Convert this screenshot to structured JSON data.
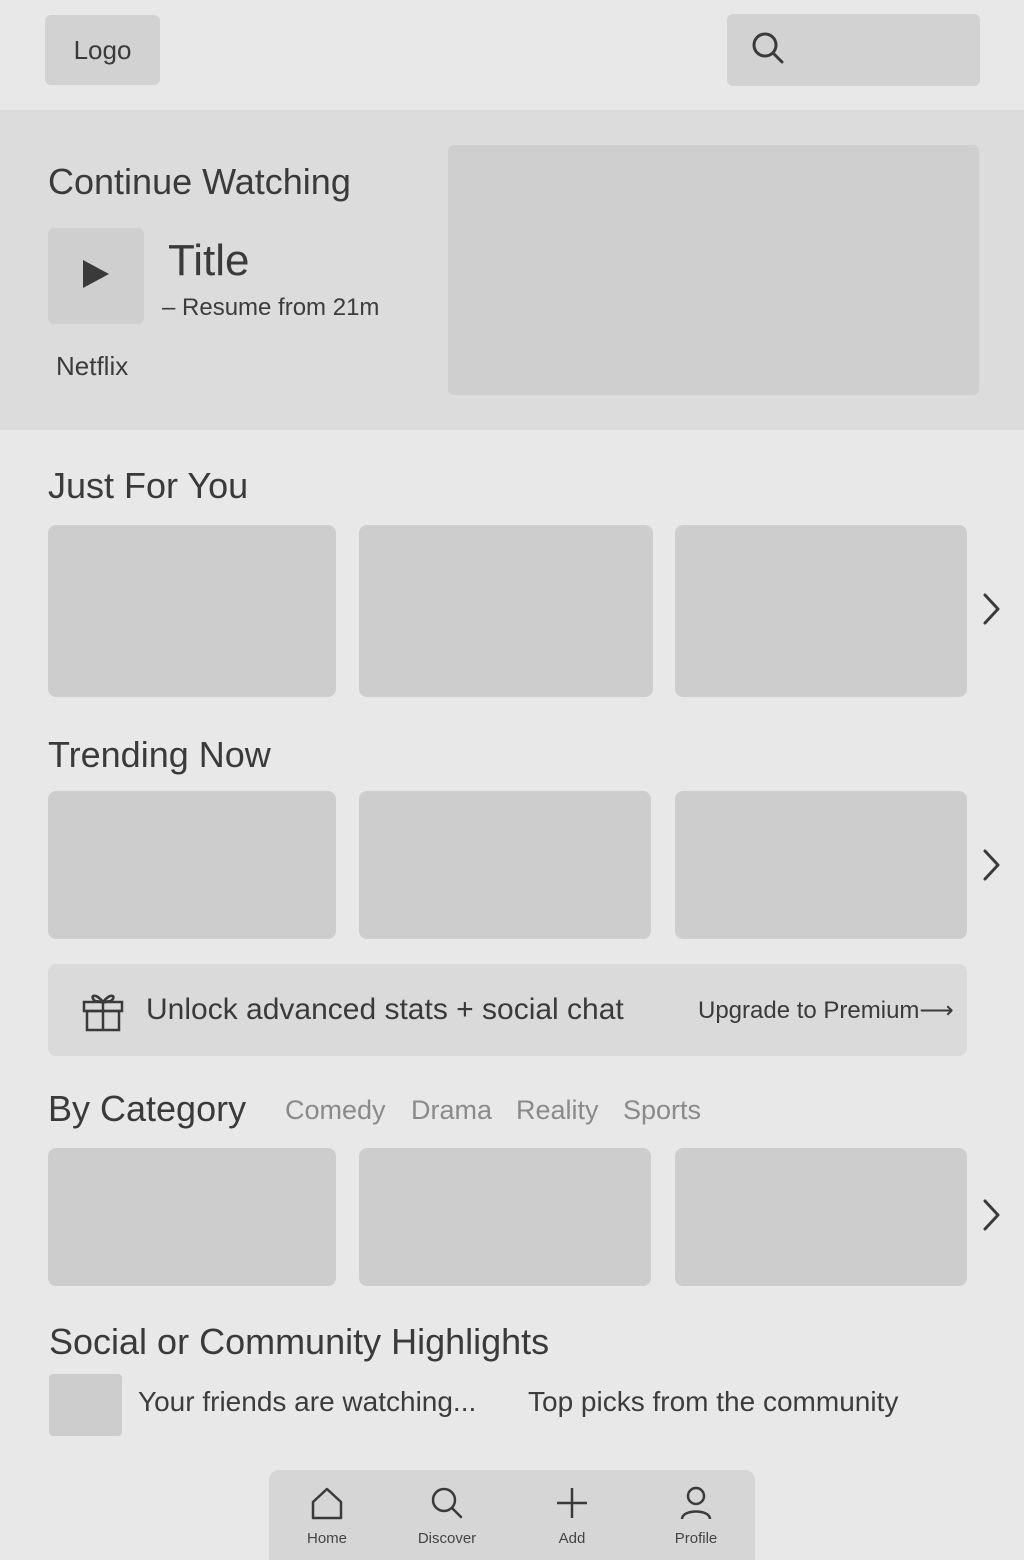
{
  "header": {
    "logo_label": "Logo",
    "search_icon": "search-icon"
  },
  "continue_watching": {
    "heading": "Continue Watching",
    "title": "Title",
    "resume": "– Resume from 21m",
    "provider": "Netflix"
  },
  "just_for_you": {
    "heading": "Just For You"
  },
  "trending_now": {
    "heading": "Trending Now"
  },
  "premium_banner": {
    "icon": "gift-icon",
    "text": "Unlock advanced stats + social chat",
    "cta": "Upgrade to Premium⟶"
  },
  "by_category": {
    "heading": "By Category",
    "tabs": [
      "Comedy",
      "Drama",
      "Reality",
      "Sports"
    ]
  },
  "social": {
    "heading": "Social or Community Highlights",
    "friends_text": "Your friends are watching...",
    "community_text": "Top picks from the community"
  },
  "tabbar": {
    "items": [
      {
        "label": "Home",
        "icon": "home-icon"
      },
      {
        "label": "Discover",
        "icon": "search-icon"
      },
      {
        "label": "Add",
        "icon": "plus-icon"
      },
      {
        "label": "Profile",
        "icon": "user-icon"
      }
    ]
  },
  "colors": {
    "background": "#e8e8e8",
    "hero_background": "#dcdcdc",
    "placeholder": "#cdcdcd",
    "text": "#3a3a3a",
    "muted_text": "#8a8a8a"
  }
}
